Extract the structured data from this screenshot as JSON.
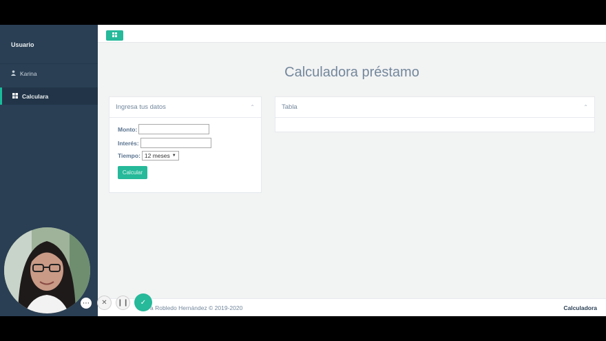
{
  "sidebar": {
    "title": "Usuario",
    "user_name": "Karina",
    "nav_item": "Calculara",
    "accent": "#1abb9c",
    "background": "#2a3f54"
  },
  "topbar": {
    "menu_icon": "grid-icon"
  },
  "page": {
    "title": "Calculadora préstamo"
  },
  "form_panel": {
    "title": "Ingresa tus datos",
    "monto_label": "Monto:",
    "monto_value": "",
    "interes_label": "Interés:",
    "interes_value": "",
    "tiempo_label": "Tiempo:",
    "tiempo_selected": "12 meses",
    "button_label": "Calcular"
  },
  "table_panel": {
    "title": "Tabla"
  },
  "footer": {
    "left_text": "a Robledo Hernández © 2019-2020",
    "right_text": "Calculadora"
  },
  "recorder": {
    "controls": [
      "more-icon",
      "close-icon",
      "pause-icon",
      "check-icon"
    ],
    "accent": "#26b99a"
  }
}
